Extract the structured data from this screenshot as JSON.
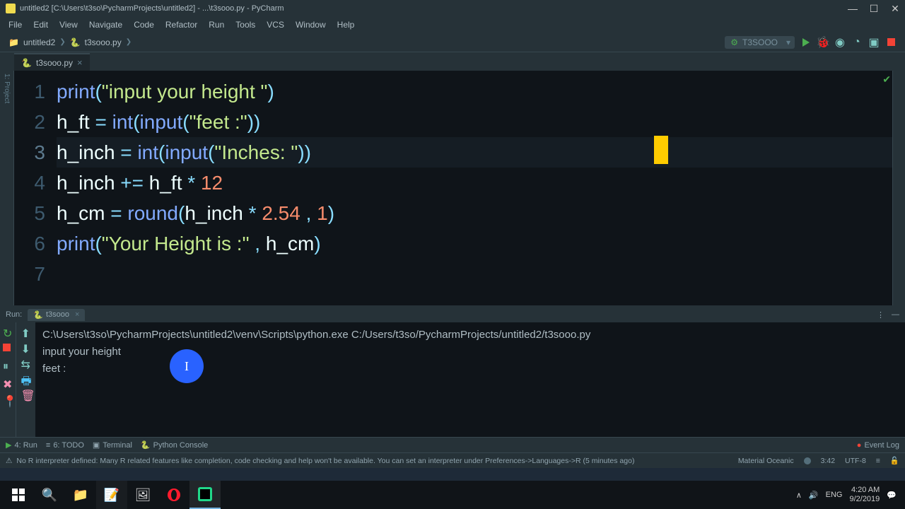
{
  "titlebar": {
    "text": "untitled2 [C:\\Users\\t3so\\PycharmProjects\\untitled2] - ...\\t3sooo.py - PyCharm"
  },
  "menu": [
    "File",
    "Edit",
    "View",
    "Navigate",
    "Code",
    "Refactor",
    "Run",
    "Tools",
    "VCS",
    "Window",
    "Help"
  ],
  "breadcrumb": {
    "project": "untitled2",
    "file": "t3sooo.py"
  },
  "run_config": "T3SOOO",
  "tab": {
    "name": "t3sooo.py"
  },
  "code": {
    "lines": [
      {
        "n": "1",
        "tokens": [
          [
            "fn",
            "print"
          ],
          [
            "op",
            "("
          ],
          [
            "str",
            "\"input your height \""
          ],
          [
            "op",
            ")"
          ]
        ]
      },
      {
        "n": "2",
        "tokens": [
          [
            "id",
            "h_ft "
          ],
          [
            "op",
            "= "
          ],
          [
            "fn",
            "int"
          ],
          [
            "op",
            "("
          ],
          [
            "fn",
            "input"
          ],
          [
            "op",
            "("
          ],
          [
            "str",
            "\"feet :\""
          ],
          [
            "op",
            "))"
          ]
        ]
      },
      {
        "n": "3",
        "tokens": [
          [
            "id",
            "h_inch "
          ],
          [
            "op",
            "= "
          ],
          [
            "fn",
            "int"
          ],
          [
            "op",
            "("
          ],
          [
            "fn",
            "input"
          ],
          [
            "op",
            "("
          ],
          [
            "str",
            "\"Inches: \""
          ],
          [
            "op",
            "))"
          ]
        ],
        "current": true
      },
      {
        "n": "4",
        "tokens": []
      },
      {
        "n": "5",
        "tokens": [
          [
            "id",
            "h_inch "
          ],
          [
            "op",
            "+= "
          ],
          [
            "id",
            "h_ft "
          ],
          [
            "op",
            "* "
          ],
          [
            "num",
            "12"
          ]
        ]
      },
      {
        "n": "6",
        "tokens": [
          [
            "id",
            "h_cm "
          ],
          [
            "op",
            "= "
          ],
          [
            "fn",
            "round"
          ],
          [
            "op",
            "("
          ],
          [
            "id",
            "h_inch "
          ],
          [
            "op",
            "* "
          ],
          [
            "num",
            "2.54"
          ],
          [
            "op",
            " , "
          ],
          [
            "num",
            "1"
          ],
          [
            "op",
            ")"
          ]
        ]
      },
      {
        "n": "7",
        "tokens": [
          [
            "fn",
            "print"
          ],
          [
            "op",
            "("
          ],
          [
            "str",
            "\"Your Height is :\""
          ],
          [
            "op",
            " , "
          ],
          [
            "id",
            "h_cm"
          ],
          [
            "op",
            ")"
          ]
        ]
      }
    ]
  },
  "run": {
    "label": "Run:",
    "tab": "t3sooo",
    "console": [
      "C:\\Users\\t3so\\PycharmProjects\\untitled2\\venv\\Scripts\\python.exe C:/Users/t3so/PycharmProjects/untitled2/t3sooo.py",
      "input your height ",
      "feet :"
    ]
  },
  "tool_windows": {
    "run": "4: Run",
    "todo": "6: TODO",
    "terminal": "Terminal",
    "pyconsole": "Python Console",
    "eventlog": "Event Log"
  },
  "status": {
    "msg": "No R interpreter defined: Many R related features like completion, code checking and help won't be available. You can set an interpreter under Preferences->Languages->R (5 minutes ago)",
    "theme": "Material Oceanic",
    "pos": "3:42",
    "enc": "UTF-8",
    "sep": "≡"
  },
  "tray": {
    "lang": "ENG",
    "time": "4:20 AM",
    "date": "9/2/2019",
    "vol": "🔊",
    "up": "∧"
  }
}
